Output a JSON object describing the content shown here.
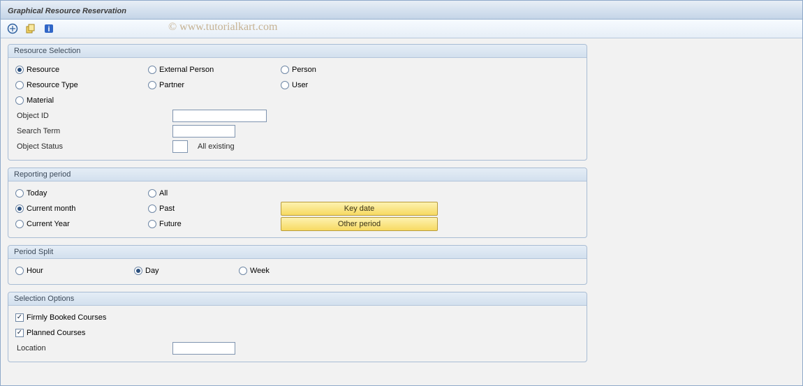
{
  "title": "Graphical Resource Reservation",
  "watermark": "© www.tutorialkart.com",
  "groups": {
    "resource_selection": {
      "title": "Resource Selection",
      "radios": {
        "resource": "Resource",
        "external_person": "External Person",
        "person": "Person",
        "resource_type": "Resource Type",
        "partner": "Partner",
        "user": "User",
        "material": "Material"
      },
      "selected": "resource",
      "object_id_label": "Object ID",
      "object_id_value": "",
      "search_term_label": "Search Term",
      "search_term_value": "",
      "object_status_label": "Object Status",
      "object_status_value": "",
      "object_status_text": "All existing"
    },
    "reporting_period": {
      "title": "Reporting period",
      "radios": {
        "today": "Today",
        "all": "All",
        "current_month": "Current month",
        "past": "Past",
        "current_year": "Current Year",
        "future": "Future"
      },
      "selected": "current_month",
      "key_date_btn": "Key date",
      "other_period_btn": "Other period"
    },
    "period_split": {
      "title": "Period Split",
      "radios": {
        "hour": "Hour",
        "day": "Day",
        "week": "Week"
      },
      "selected": "day"
    },
    "selection_options": {
      "title": "Selection Options",
      "firmly_booked_label": "Firmly Booked Courses",
      "firmly_booked_checked": true,
      "planned_label": "Planned Courses",
      "planned_checked": true,
      "location_label": "Location",
      "location_value": ""
    }
  },
  "toolbar_icons": [
    "execute-icon",
    "variant-icon",
    "info-icon"
  ]
}
